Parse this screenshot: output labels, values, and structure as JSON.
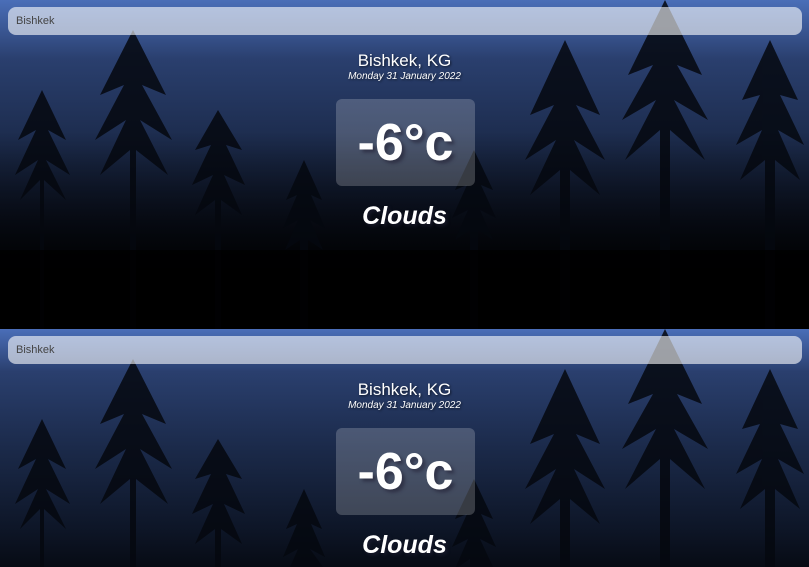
{
  "panels": [
    {
      "search": {
        "value": "Bishkek"
      },
      "location": "Bishkek, KG",
      "date": "Monday 31 January 2022",
      "temperature": "-6°c",
      "weather": "Clouds"
    },
    {
      "search": {
        "value": "Bishkek"
      },
      "location": "Bishkek, KG",
      "date": "Monday 31 January 2022",
      "temperature": "-6°c",
      "weather": "Clouds"
    }
  ],
  "colors": {
    "sky_top": "#4a6eb8",
    "sky_bottom": "#000000"
  }
}
